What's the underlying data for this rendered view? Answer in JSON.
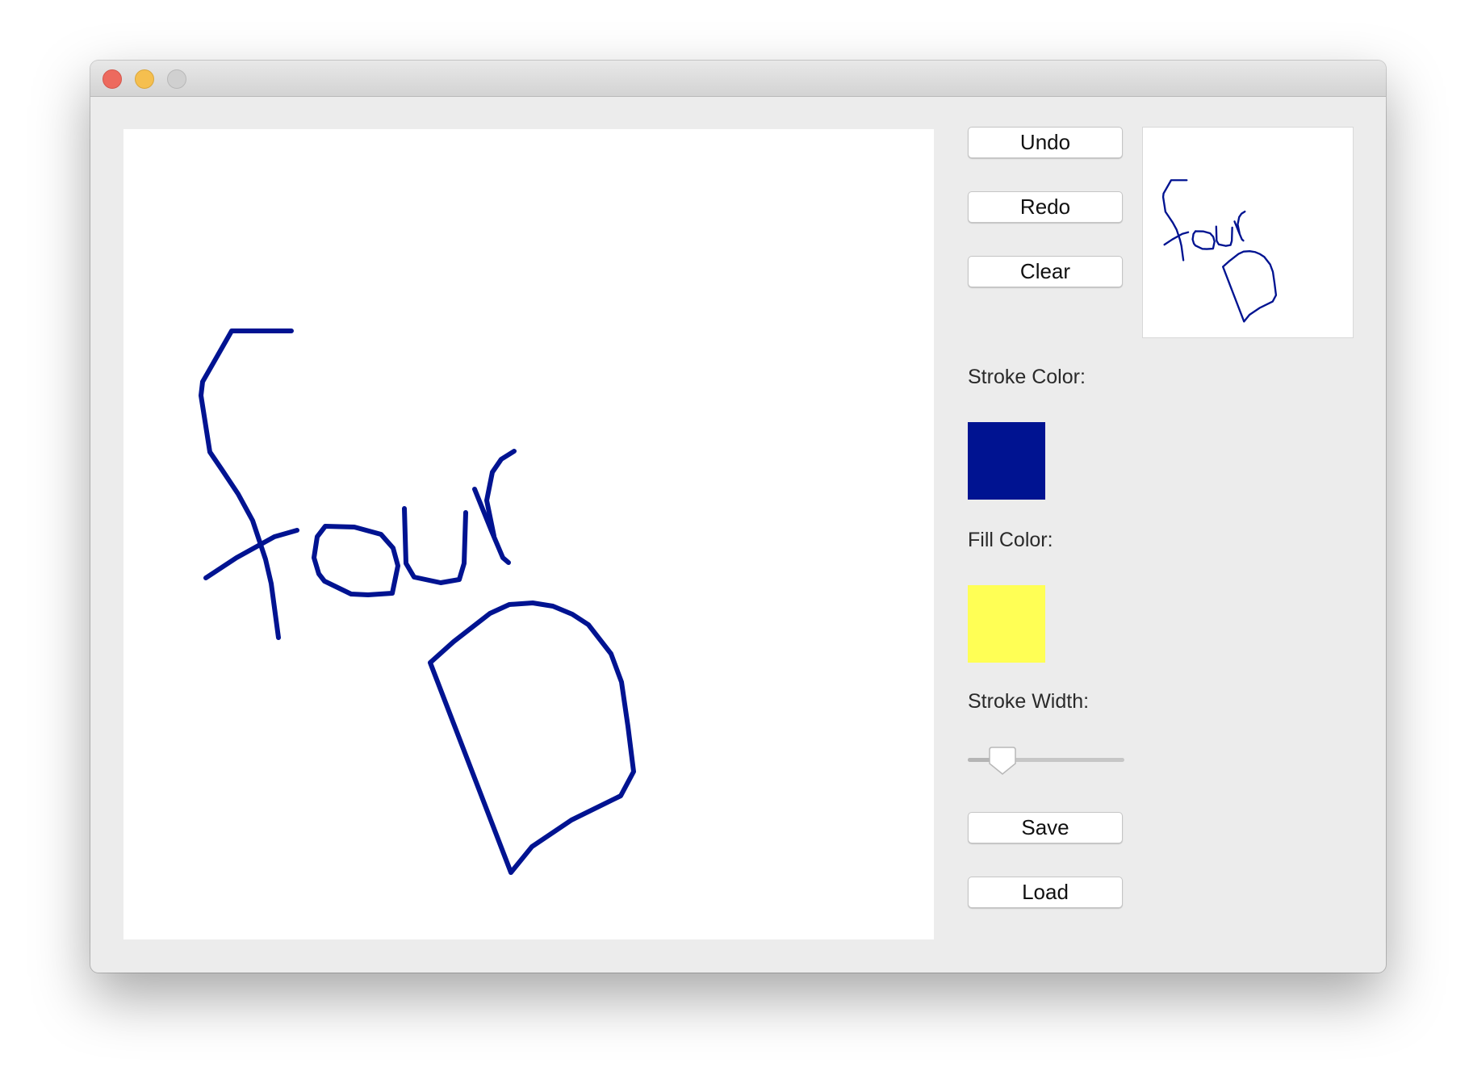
{
  "window": {
    "traffic_lights": [
      "close",
      "minimize",
      "zoom"
    ]
  },
  "toolbar": {
    "undo_label": "Undo",
    "redo_label": "Redo",
    "clear_label": "Clear",
    "save_label": "Save",
    "load_label": "Load"
  },
  "properties": {
    "stroke_color_label": "Stroke Color:",
    "stroke_color": "#001391",
    "fill_color_label": "Fill Color:",
    "fill_color": "#ffff55",
    "stroke_width_label": "Stroke Width:",
    "stroke_width_fraction": 0.22
  },
  "drawing": {
    "stroke_color": "#001391"
  }
}
